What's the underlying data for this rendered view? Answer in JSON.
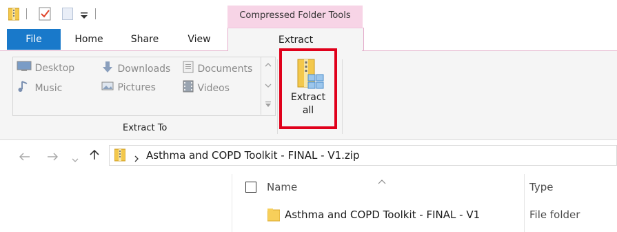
{
  "qat": {
    "icons": [
      "zip-folder-icon",
      "properties-check-icon",
      "new-folder-icon",
      "customize-dropdown-icon"
    ]
  },
  "ribbon": {
    "tabs": {
      "file": "File",
      "home": "Home",
      "share": "Share",
      "view": "View",
      "extract": "Extract"
    },
    "contextual_header": "Compressed Folder Tools",
    "extract_to": {
      "items": {
        "desktop": "Desktop",
        "downloads": "Downloads",
        "documents": "Documents",
        "music": "Music",
        "pictures": "Pictures",
        "videos": "Videos"
      },
      "group_label": "Extract To"
    },
    "extract_all": {
      "line1": "Extract",
      "line2": "all"
    }
  },
  "address": {
    "path": "Asthma and COPD Toolkit - FINAL - V1.zip"
  },
  "file_list": {
    "columns": {
      "name": "Name",
      "type": "Type"
    },
    "rows": [
      {
        "name": "Asthma and COPD Toolkit  - FINAL - V1",
        "type": "File folder"
      }
    ]
  },
  "colors": {
    "file_tab": "#1979ca",
    "contextual_tab": "#f7d4e6",
    "highlight": "#e0001b"
  }
}
